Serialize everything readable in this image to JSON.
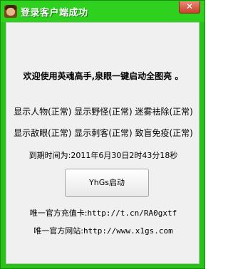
{
  "window": {
    "title": "登录客户端成功",
    "close_label": "✕"
  },
  "content": {
    "welcome": "欢迎使用英魂高手,泉眼一键启动全图亮 。",
    "status_line_1": "显示人物(正常) 显示野怪(正常) 迷雾祛除(正常)",
    "status_line_2": "显示敌眼(正常) 显示刺客(正常) 致盲免疫(正常)",
    "expire_label": "到期时间为:",
    "expire_value": "2011年6月30日2时43分18秒",
    "launch_button": "YhGs启动",
    "card_label": "唯一官方充值卡:",
    "card_url": "http://t.cn/RA0gxtf",
    "site_label": "唯一官方网站:",
    "site_url": "http://www.x1gs.com"
  }
}
